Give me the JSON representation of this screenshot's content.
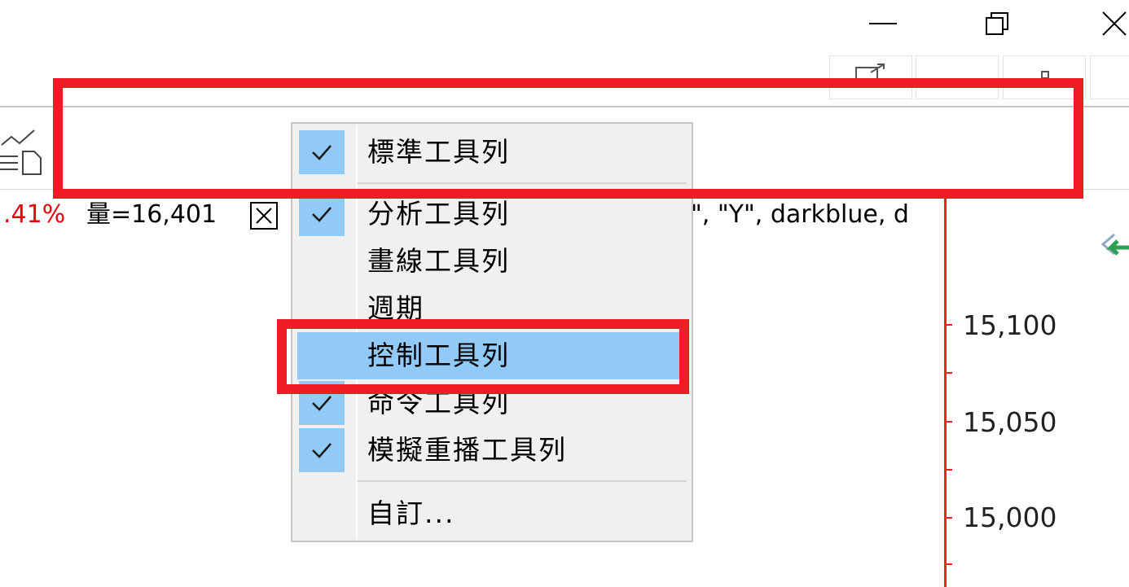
{
  "window": {
    "minimize_icon": "minimize-icon",
    "restore_icon": "restore-icon",
    "close_icon": "close-icon"
  },
  "info_bar": {
    "change_pct": ".41%",
    "volume": "量=16,401",
    "formula_snippet": "\", \"Y\", darkblue, d"
  },
  "menu": {
    "items": [
      {
        "label": "標準工具列",
        "checked": true
      },
      {
        "label": "分析工具列",
        "checked": true
      },
      {
        "label": "畫線工具列",
        "checked": false
      },
      {
        "label": "週期",
        "checked": false
      },
      {
        "label": "控制工具列",
        "checked": false,
        "highlighted": true
      },
      {
        "label": "命令工具列",
        "checked": true
      },
      {
        "label": "模擬重播工具列",
        "checked": true
      },
      {
        "label": "自訂...",
        "checked": false
      }
    ]
  },
  "axis": {
    "labels": [
      "15,100",
      "15,050",
      "15,000"
    ]
  },
  "colors": {
    "accent_red": "#ee1c25",
    "menu_highlight": "#91c9f7",
    "axis_red": "#ff1e1e"
  }
}
